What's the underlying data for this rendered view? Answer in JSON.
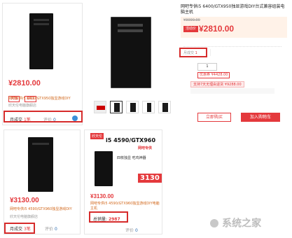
{
  "top_left": {
    "price": "¥2810.00",
    "tags": [
      "天猫",
      "双11"
    ],
    "title": "网吧专供i5 6400/GTX950独显游戏DIY",
    "shop": "欣天伦电脑旗舰店",
    "sales_label": "月成交",
    "sales_value": "1笔",
    "review_label": "评价",
    "review_value": "0"
  },
  "detail": {
    "title": "网吧专供i5 6400/GTX950独显游戏DIY台式兼容组装电脑主机",
    "promo_label": "活动价",
    "price": "¥2810.00",
    "orig_price": "¥3000.00",
    "monthly_sales_label": "月成交",
    "monthly_sales": "1",
    "qty": "1",
    "coupon": "优惠券 ¥4428.00",
    "service_note": "支持7天无理由退货 ¥9288.00",
    "buy_label": "立即购买",
    "cart_label": "加入购物车"
  },
  "bottom_left": {
    "price": "¥3130.00",
    "title": "网吧专供i5 4590/GTX960独显游戏DIY",
    "shop": "欣天伦电脑旗舰店",
    "sales_label": "月成交",
    "sales_value": "3笔",
    "review_label": "评价",
    "review_value": "0"
  },
  "bottom_mid": {
    "badge": "欣天伦",
    "banner_title": "i5 4590/GTX960",
    "banner_sub": "网吧专供",
    "banner_line": "四核独显 吃鸡神器",
    "banner_price": "3130",
    "price": "¥3130.00",
    "title": "网吧专供i5 4590/GTX960独显游戏DIY电脑主机",
    "total_sales_label": "总销量:",
    "total_sales_value": "2987",
    "review_label": "评价",
    "review_value": "0"
  },
  "watermark": "系统之家",
  "colors": {
    "accent": "#e4393c",
    "highlight": "#d62b2b"
  }
}
